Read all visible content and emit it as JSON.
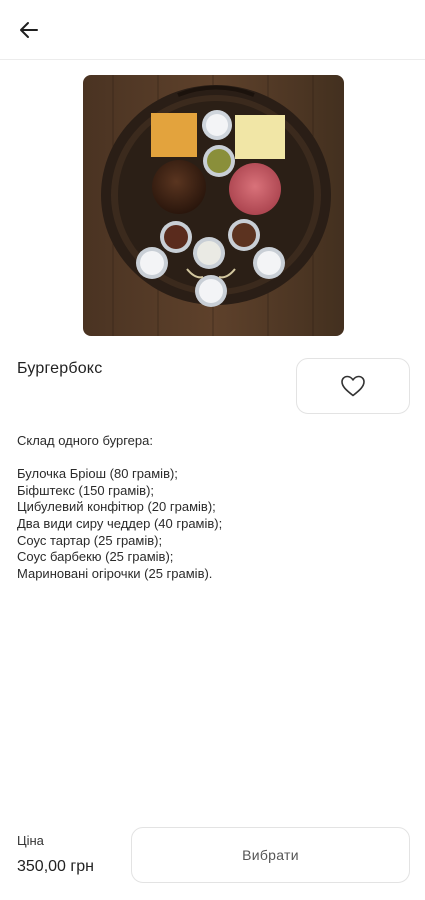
{
  "header": {
    "back_icon": "arrow-left-icon"
  },
  "product": {
    "title": "Бургербокс",
    "image_alt": "burger box ingredients on wooden board",
    "favorite_icon": "heart-outline-icon",
    "description": {
      "heading": "Склад одного бургера:",
      "items": [
        "Булочка Бріош (80 грамів);",
        "Біфштекс (150 грамів);",
        "Цибулевий конфітюр (20 грамів);",
        "Два види сиру чеддер (40 грамів);",
        "Соус тартар (25 грамів);",
        "Соус барбекю (25 грамів);",
        "Мариновані огірочки (25 грамів)."
      ]
    }
  },
  "footer": {
    "price_label": "Ціна",
    "price_value": "350,00 грн",
    "choose_label": "Вибрати"
  },
  "colors": {
    "background": "#ffffff",
    "border": "#e3e3e3",
    "text": "#222222"
  }
}
